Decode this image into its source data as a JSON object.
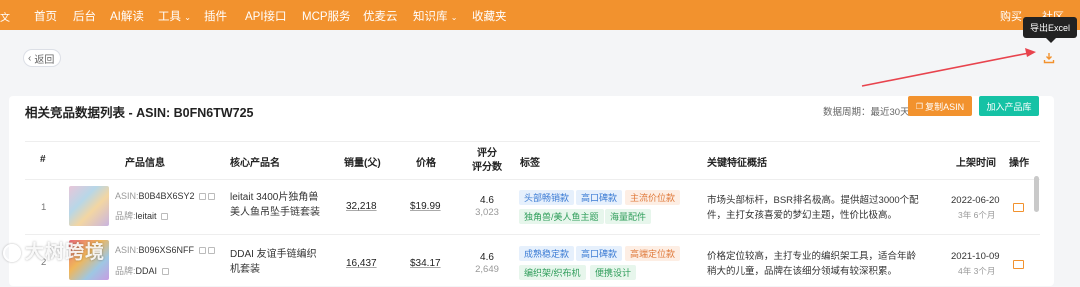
{
  "nav": {
    "cut_item": "文",
    "items": [
      "首页",
      "后台",
      "AI解读",
      "工具",
      "插件",
      "API接口",
      "MCP服务",
      "优麦云",
      "知识库",
      "收藏夹"
    ],
    "right_items": [
      "购买",
      "社区"
    ]
  },
  "tooltip": "导出Excel",
  "back_label": "返回",
  "card": {
    "title": "相关竞品数据列表 - ASIN: B0FN6TW725",
    "period": "数据周期：最近30天",
    "copy_button": "复制ASIN",
    "add_button": "加入产品库"
  },
  "table": {
    "headers": {
      "index": "#",
      "product_info": "产品信息",
      "core_name": "核心产品名",
      "sales": "销量(父)",
      "price": "价格",
      "rating_line1": "评分",
      "rating_line2": "评分数",
      "tags": "标签",
      "features": "关键特征概括",
      "launch": "上架时间",
      "ops": "操作"
    },
    "rows": [
      {
        "index": "1",
        "asin_label": "ASIN:",
        "asin": "B0B4BX6SY2",
        "brand_label": "品牌:",
        "brand": "leitait",
        "name": "leitait 3400片独角兽美人鱼吊坠手链套装",
        "sales": "32,218",
        "price": "$19.99",
        "rating": "4.6",
        "rating_count": "3,023",
        "tags": [
          "头部畅销款",
          "高口碑款",
          "主流价位款",
          "独角兽/美人鱼主题",
          "海量配件"
        ],
        "feature": "市场头部标杆，BSR排名极高。提供超过3000个配件，主打女孩喜爱的梦幻主题，性价比极高。",
        "date": "2022-06-20",
        "age": "3年 6个月"
      },
      {
        "index": "2",
        "asin_label": "ASIN:",
        "asin": "B096XS6NFF",
        "brand_label": "品牌:",
        "brand": "DDAI",
        "name": "DDAI 友谊手链编织机套装",
        "sales": "16,437",
        "price": "$34.17",
        "rating": "4.6",
        "rating_count": "2,649",
        "tags": [
          "成熟稳定款",
          "高口碑款",
          "高端定位款",
          "编织架/织布机",
          "便携设计"
        ],
        "feature": "价格定位较高，主打专业的编织架工具，适合年龄稍大的儿童，品牌在该细分领域有较深积累。",
        "date": "2021-10-09",
        "age": "4年 3个月"
      }
    ]
  },
  "watermark": "大树跨境",
  "colors": {
    "brand_orange": "#f2922e",
    "teal": "#15c2a5",
    "arrow_red": "#e8434d"
  },
  "icons": [
    "chevron-down-icon",
    "chevron-left-icon",
    "download-icon",
    "copy-icon",
    "link-icon",
    "edit-icon"
  ]
}
